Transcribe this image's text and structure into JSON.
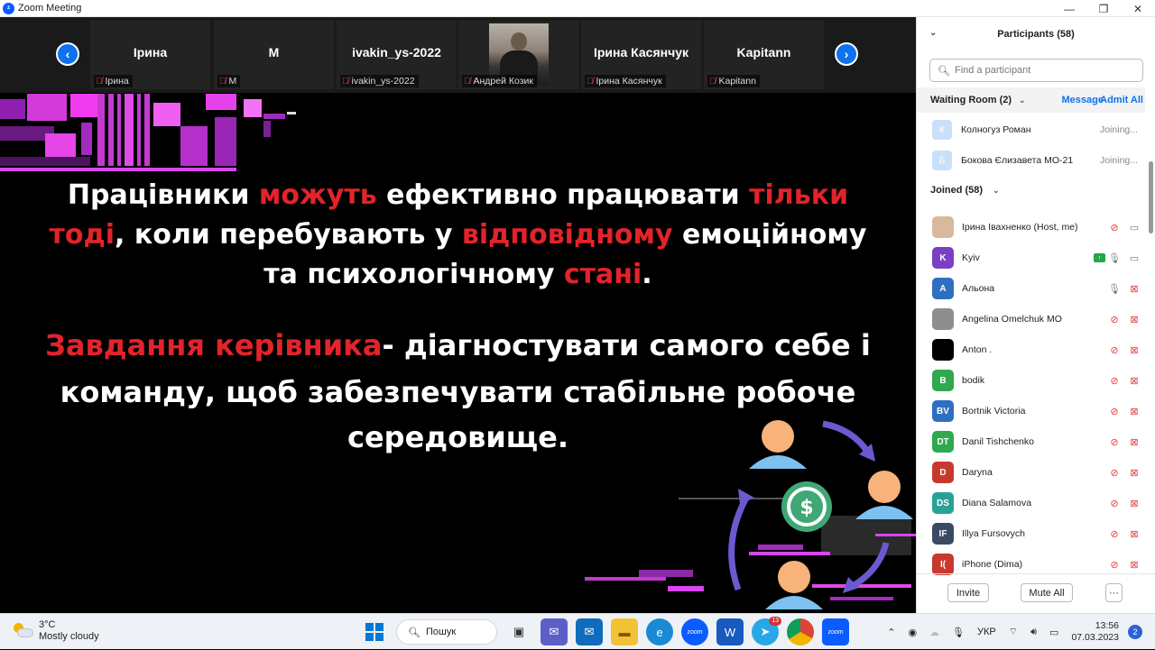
{
  "window": {
    "title": "Zoom Meeting"
  },
  "video_strip": {
    "tiles": [
      {
        "big_name": "Ірина",
        "label": "Ірина"
      },
      {
        "big_name": "M",
        "label": "M"
      },
      {
        "big_name": "ivakin_ys-2022",
        "label": "ivakin_ys-2022"
      },
      {
        "big_name": "",
        "label": "Андрей Козик"
      },
      {
        "big_name": "Ірина Касянчук",
        "label": "Ірина Касянчук"
      },
      {
        "big_name": "Kapitann",
        "label": "Kapitann"
      }
    ]
  },
  "slide": {
    "p1_line1": {
      "a": "Працівники ",
      "b": "можуть",
      "c": " ефективно працювати ",
      "d": "тільки"
    },
    "p1_line2": {
      "a": "тоді",
      "b": ", коли перебувають у ",
      "c": "відповідному",
      "d": " емоційному"
    },
    "p1_line3": {
      "a": "та психологічному ",
      "b": "стані",
      "c": "."
    },
    "p2_line1": {
      "a": "Завдання керівника",
      "b": "- діагностувати самого себе і"
    },
    "p2_line2": "команду, щоб забезпечувати стабільне робоче",
    "p2_line3": "середовище."
  },
  "participants": {
    "header": "Participants (58)",
    "search_placeholder": "Find a participant",
    "waiting_room": {
      "label": "Waiting Room (2)",
      "message_button": "Message",
      "admit_all_button": "Admit All",
      "people": [
        {
          "initial": "К",
          "name": "Колногуз Роман",
          "status": "Joining..."
        },
        {
          "initial": "Б",
          "name": "Бокова Єлизавета МО-21",
          "status": "Joining..."
        }
      ]
    },
    "joined_label": "Joined (58)",
    "list": [
      {
        "initials": "",
        "name": "Ірина Івахненко (Host, me)",
        "color": "#d9b99b"
      },
      {
        "initials": "K",
        "name": "Kyiv",
        "color": "#7b3fc4"
      },
      {
        "initials": "А",
        "name": "Альона",
        "color": "#2e6fc1"
      },
      {
        "initials": "",
        "name": "Angelina Omelchuk MO",
        "color": "#8e8e8e"
      },
      {
        "initials": "",
        "name": "Anton .",
        "color": "#000000"
      },
      {
        "initials": "B",
        "name": "bodik",
        "color": "#2fa84f"
      },
      {
        "initials": "BV",
        "name": "Bortnik Victoria",
        "color": "#2e6fc1"
      },
      {
        "initials": "DT",
        "name": "Danil Tishchenko",
        "color": "#2fa84f"
      },
      {
        "initials": "D",
        "name": "Daryna",
        "color": "#c63a2e"
      },
      {
        "initials": "DS",
        "name": "Diana Salamova",
        "color": "#2aa198"
      },
      {
        "initials": "IF",
        "name": "Illya Fursovych",
        "color": "#3b4a63"
      },
      {
        "initials": "I(",
        "name": "iPhone (Dima)",
        "color": "#c63a2e"
      }
    ],
    "footer": {
      "invite": "Invite",
      "mute_all": "Mute All",
      "more": "···"
    }
  },
  "taskbar": {
    "weather_temp": "3°C",
    "weather_desc": "Mostly cloudy",
    "search_label": "Пошук",
    "telegram_badge": "13",
    "language": "УКР",
    "time": "13:56",
    "date": "07.03.2023",
    "notifications": "2"
  }
}
